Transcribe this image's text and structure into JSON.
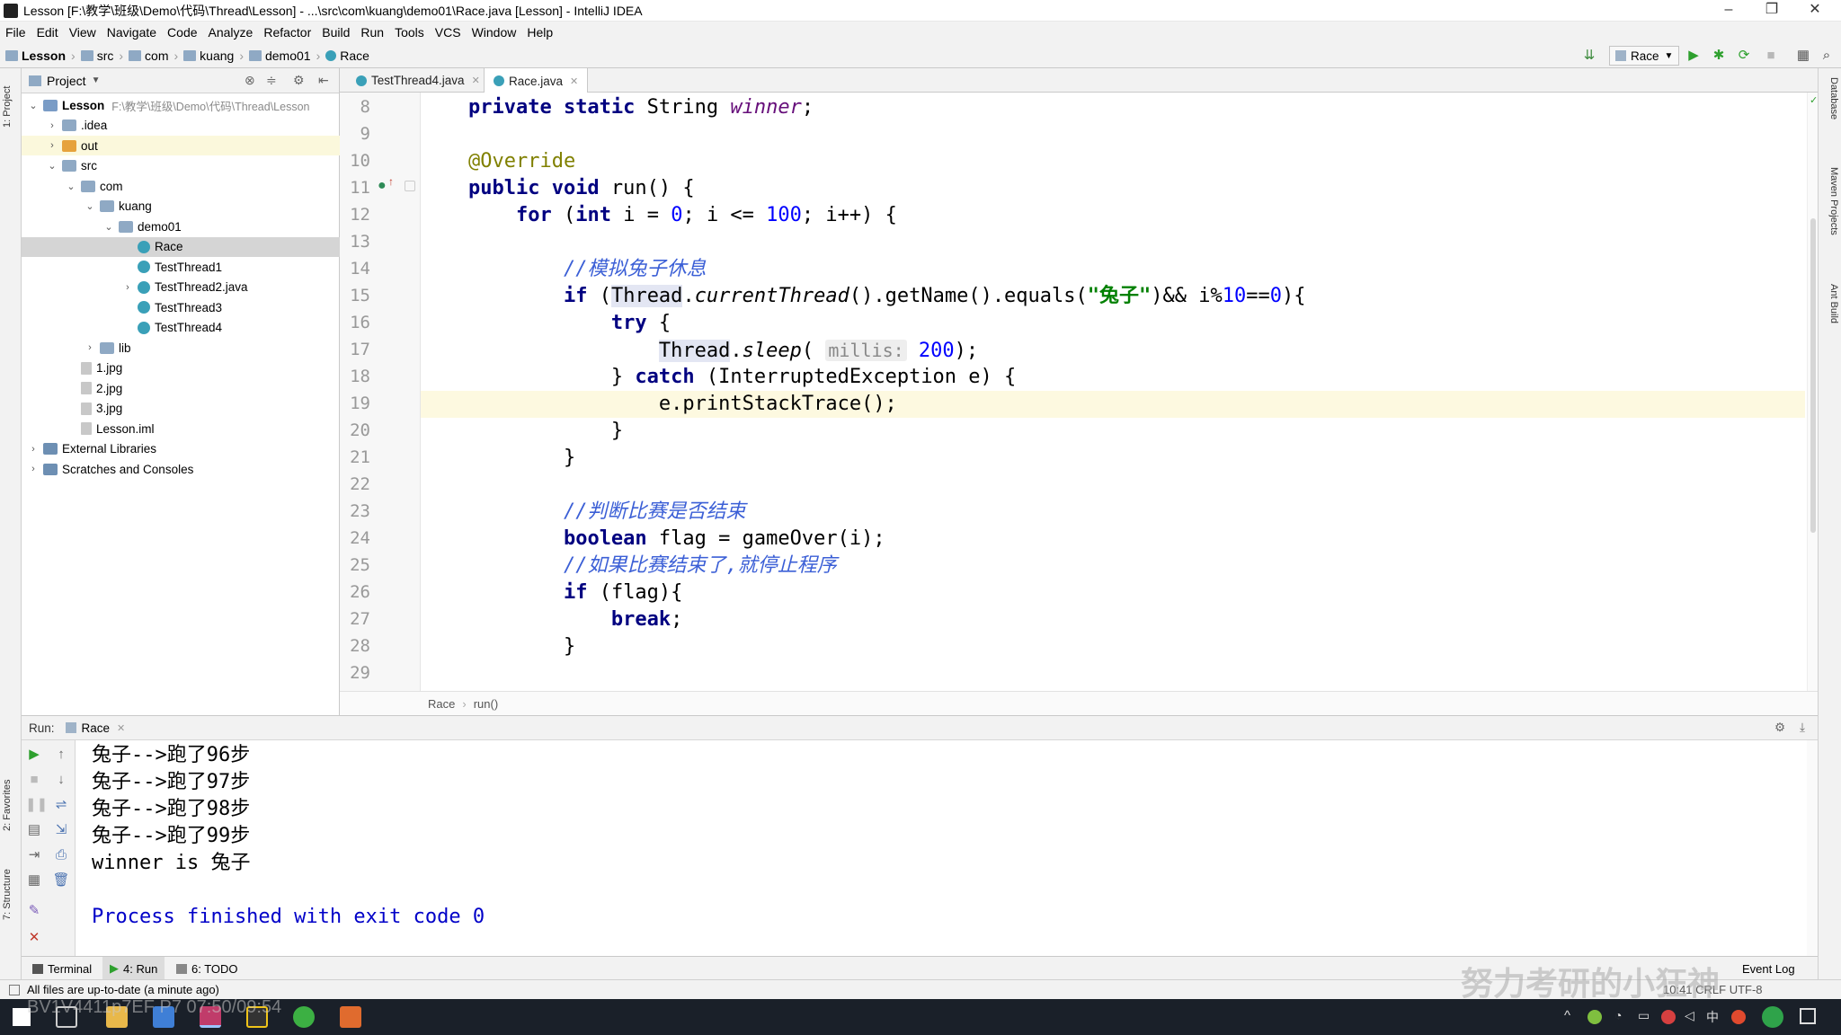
{
  "window": {
    "title": "Lesson [F:\\教学\\班级\\Demo\\代码\\Thread\\Lesson] - ...\\src\\com\\kuang\\demo01\\Race.java [Lesson] - IntelliJ IDEA",
    "minimize": "–",
    "restore": "❐",
    "close": "✕"
  },
  "menu": [
    "File",
    "Edit",
    "View",
    "Navigate",
    "Code",
    "Analyze",
    "Refactor",
    "Build",
    "Run",
    "Tools",
    "VCS",
    "Window",
    "Help"
  ],
  "breadcrumb": [
    "Lesson",
    "src",
    "com",
    "kuang",
    "demo01",
    "Race"
  ],
  "toolbar": {
    "run_config": "Race",
    "run_icon": "▶",
    "debug_icon": "✱",
    "search_icon": "⌕"
  },
  "left_strip": {
    "project": "1: Project",
    "favorites": "2: Favorites",
    "structure": "7: Structure"
  },
  "right_strip": {
    "database": "Database",
    "maven": "Maven Projects",
    "ant": "Ant Build"
  },
  "project_panel": {
    "title": "Project",
    "tree": [
      {
        "label": "Lesson",
        "path": "F:\\教学\\班级\\Demo\\代码\\Thread\\Lesson",
        "indent": 0,
        "arrow": "v",
        "icon": "module",
        "bold": true
      },
      {
        "label": ".idea",
        "indent": 1,
        "arrow": ">",
        "icon": "folder"
      },
      {
        "label": "out",
        "indent": 1,
        "arrow": ">",
        "icon": "folder-o",
        "highlight": "yellow"
      },
      {
        "label": "src",
        "indent": 1,
        "arrow": "v",
        "icon": "folder"
      },
      {
        "label": "com",
        "indent": 2,
        "arrow": "v",
        "icon": "folder"
      },
      {
        "label": "kuang",
        "indent": 3,
        "arrow": "v",
        "icon": "folder"
      },
      {
        "label": "demo01",
        "indent": 4,
        "arrow": "v",
        "icon": "folder"
      },
      {
        "label": "Race",
        "indent": 5,
        "arrow": "",
        "icon": "cls",
        "selected": true
      },
      {
        "label": "TestThread1",
        "indent": 5,
        "arrow": "",
        "icon": "cls"
      },
      {
        "label": "TestThread2.java",
        "indent": 5,
        "arrow": ">",
        "icon": "cls"
      },
      {
        "label": "TestThread3",
        "indent": 5,
        "arrow": "",
        "icon": "cls"
      },
      {
        "label": "TestThread4",
        "indent": 5,
        "arrow": "",
        "icon": "cls"
      },
      {
        "label": "lib",
        "indent": 3,
        "arrow": ">",
        "icon": "folder"
      },
      {
        "label": "1.jpg",
        "indent": 2,
        "arrow": "",
        "icon": "file"
      },
      {
        "label": "2.jpg",
        "indent": 2,
        "arrow": "",
        "icon": "file"
      },
      {
        "label": "3.jpg",
        "indent": 2,
        "arrow": "",
        "icon": "file"
      },
      {
        "label": "Lesson.iml",
        "indent": 2,
        "arrow": "",
        "icon": "file"
      },
      {
        "label": "External Libraries",
        "indent": 0,
        "arrow": ">",
        "icon": "lib"
      },
      {
        "label": "Scratches and Consoles",
        "indent": 0,
        "arrow": ">",
        "icon": "lib"
      }
    ]
  },
  "editor": {
    "tabs": [
      {
        "label": "TestThread4.java",
        "active": false
      },
      {
        "label": "Race.java",
        "active": true
      }
    ],
    "current_line": 19,
    "lines": [
      {
        "n": "8",
        "html": "    <span class=\"kw\">private static</span> String <span class=\"fld\">winner</span>;"
      },
      {
        "n": "9",
        "html": ""
      },
      {
        "n": "10",
        "html": "    <span class=\"ann\">@Override</span>"
      },
      {
        "n": "11",
        "html": "    <span class=\"kw\">public void</span> run() {"
      },
      {
        "n": "12",
        "html": "        <span class=\"kw\">for</span> (<span class=\"kw\">int</span> i = <span class=\"num\">0</span>; i &lt;= <span class=\"num\">100</span>; i++) {"
      },
      {
        "n": "13",
        "html": ""
      },
      {
        "n": "14",
        "html": "            <span class=\"cmt\">//模拟兔子休息</span>"
      },
      {
        "n": "15",
        "html": "            <span class=\"kw\">if</span> (<span class=\"hl\">Thread</span>.<span class=\"stat\">currentThread</span>().getName().equals(<span class=\"str\">\"兔子\"</span>)&amp;&amp; i%<span class=\"num\">10</span>==<span class=\"num\">0</span>){"
      },
      {
        "n": "16",
        "html": "                <span class=\"kw\">try</span> {"
      },
      {
        "n": "17",
        "html": "                    <span class=\"hl\">Thread</span>.<span class=\"stat\">sleep</span>( <span class=\"hint\">millis:</span> <span class=\"num\">200</span>);"
      },
      {
        "n": "18",
        "html": "                } <span class=\"kw\">catch</span> (InterruptedException e) {"
      },
      {
        "n": "19",
        "html": "                    e.printStackTrace();"
      },
      {
        "n": "20",
        "html": "                }"
      },
      {
        "n": "21",
        "html": "            }"
      },
      {
        "n": "22",
        "html": ""
      },
      {
        "n": "23",
        "html": "            <span class=\"cmt\">//判断比赛是否结束</span>"
      },
      {
        "n": "24",
        "html": "            <span class=\"kw\">boolean</span> flag = gameOver(i);"
      },
      {
        "n": "25",
        "html": "            <span class=\"cmt\">//如果比赛结束了,就停止程序</span>"
      },
      {
        "n": "26",
        "html": "            <span class=\"kw\">if</span> (flag){"
      },
      {
        "n": "27",
        "html": "                <span class=\"kw\">break</span>;"
      },
      {
        "n": "28",
        "html": "            }"
      },
      {
        "n": "29",
        "html": ""
      }
    ],
    "crumb": [
      "Race",
      "run()"
    ]
  },
  "run_panel": {
    "label": "Run:",
    "tab": "Race",
    "output": [
      {
        "text": "兔子-->跑了96步",
        "cls": ""
      },
      {
        "text": "兔子-->跑了97步",
        "cls": ""
      },
      {
        "text": "兔子-->跑了98步",
        "cls": ""
      },
      {
        "text": "兔子-->跑了99步",
        "cls": ""
      },
      {
        "text": "winner is 兔子",
        "cls": ""
      },
      {
        "text": "",
        "cls": ""
      },
      {
        "text": "Process finished with exit code 0",
        "cls": "proc"
      }
    ]
  },
  "bottom_tabs": {
    "terminal": "Terminal",
    "run": "4: Run",
    "todo": "6: TODO",
    "event_log": "Event Log"
  },
  "status": {
    "message": "All files are up-to-date (a minute ago)",
    "right": "10:41  CRLF  UTF-8"
  },
  "watermark": "努力考研的小狂神",
  "overlay": "BV1V4411p7EF  P7  07:50/09:54"
}
